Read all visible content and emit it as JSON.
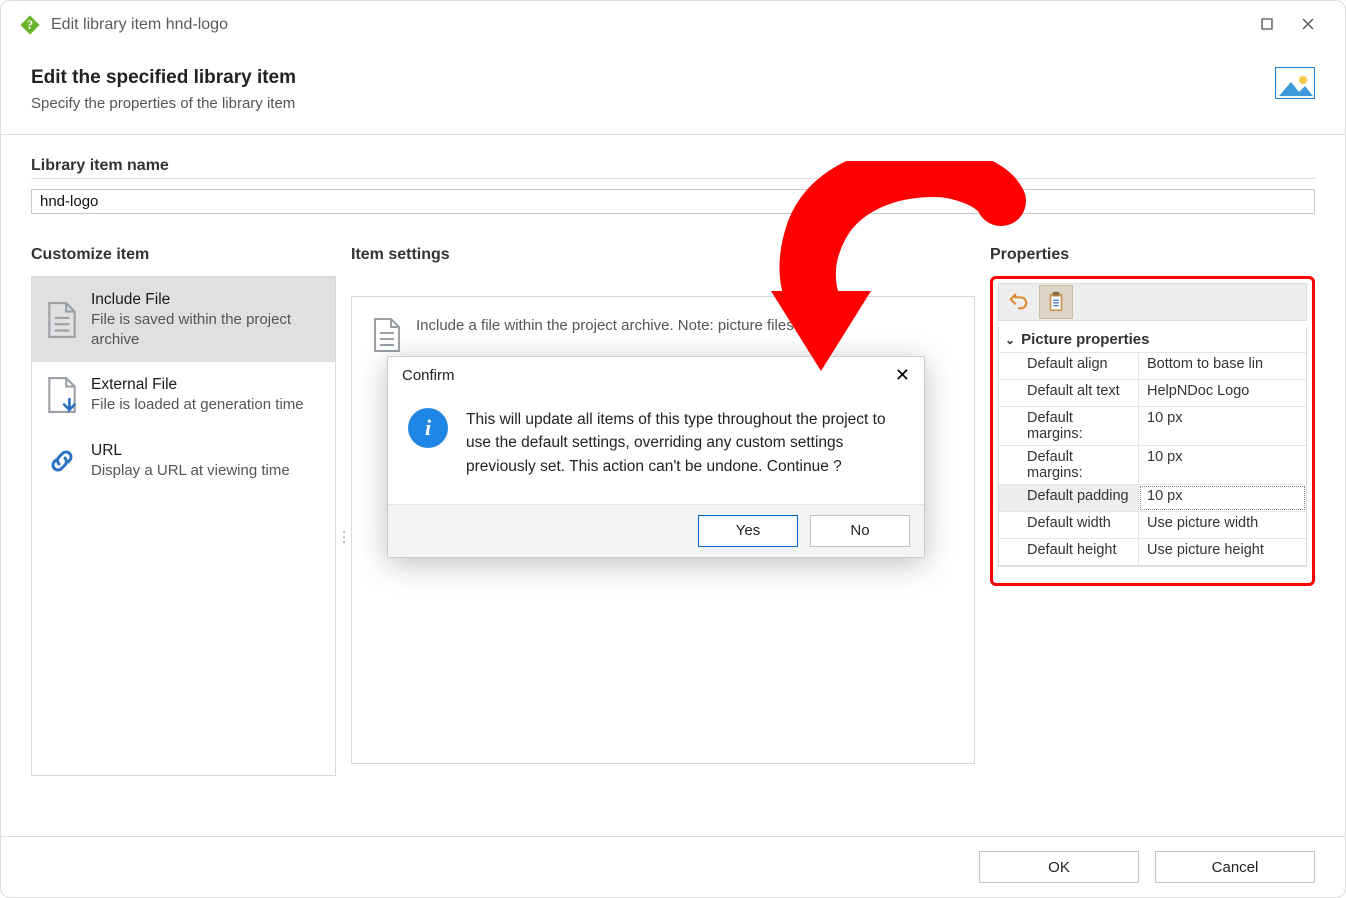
{
  "window": {
    "title": "Edit library item hnd-logo"
  },
  "header": {
    "title": "Edit the specified library item",
    "subtitle": "Specify the properties of the library item"
  },
  "library_name": {
    "label": "Library item name",
    "value": "hnd-logo"
  },
  "columns": {
    "left_head": "Customize item",
    "mid_head": "Item settings",
    "right_head": "Properties"
  },
  "customize_items": [
    {
      "title": "Include File",
      "desc": "File is saved within the project archive",
      "selected": true
    },
    {
      "title": "External File",
      "desc": "File is loaded at generation time",
      "selected": false
    },
    {
      "title": "URL",
      "desc": "Display a URL at viewing time",
      "selected": false
    }
  ],
  "item_settings": {
    "description": "Include a file within the project archive. Note: picture files are",
    "placeholder_brand": "HelpNDoc"
  },
  "properties": {
    "group": "Picture properties",
    "rows": [
      {
        "key": "Default align",
        "val": "Bottom to base lin",
        "selected": false
      },
      {
        "key": "Default alt text",
        "val": "HelpNDoc Logo",
        "selected": false
      },
      {
        "key": "Default margins:",
        "val": "10 px",
        "selected": false
      },
      {
        "key": "Default margins:",
        "val": "10 px",
        "selected": false
      },
      {
        "key": "Default padding",
        "val": "10 px",
        "selected": true
      },
      {
        "key": "Default width",
        "val": "Use picture width",
        "selected": false
      },
      {
        "key": "Default height",
        "val": "Use picture height",
        "selected": false
      }
    ]
  },
  "confirm": {
    "title": "Confirm",
    "message": "This will update all items of this type throughout the project to use the default settings, overriding any custom settings previously set. This action can't be undone. Continue ?",
    "yes": "Yes",
    "no": "No"
  },
  "footer": {
    "ok": "OK",
    "cancel": "Cancel"
  }
}
